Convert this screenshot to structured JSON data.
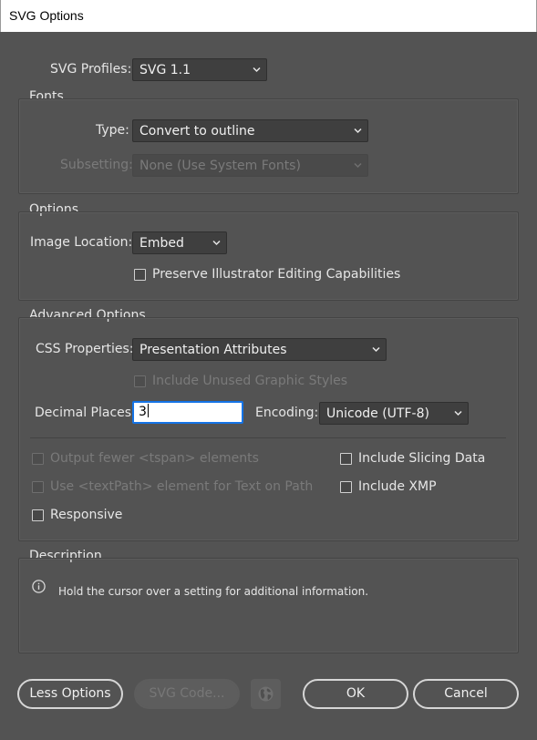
{
  "window": {
    "title": "SVG Options"
  },
  "profiles": {
    "label": "SVG Profiles:",
    "value": "SVG 1.1"
  },
  "fonts": {
    "title": "Fonts",
    "type_label": "Type:",
    "type_value": "Convert to outline",
    "subsetting_label": "Subsetting:",
    "subsetting_value": "None (Use System Fonts)"
  },
  "options": {
    "title": "Options",
    "image_location_label": "Image Location:",
    "image_location_value": "Embed",
    "preserve_label": "Preserve Illustrator Editing Capabilities"
  },
  "advanced": {
    "title": "Advanced Options",
    "css_label": "CSS Properties:",
    "css_value": "Presentation Attributes",
    "unused_styles_label": "Include Unused Graphic Styles",
    "decimal_label": "Decimal Places:",
    "decimal_value": "3",
    "encoding_label": "Encoding:",
    "encoding_value": "Unicode (UTF-8)",
    "fewer_tspan_label": "Output fewer <tspan> elements",
    "textpath_label": "Use <textPath> element for Text on Path",
    "responsive_label": "Responsive",
    "slicing_label": "Include Slicing Data",
    "xmp_label": "Include XMP"
  },
  "description": {
    "title": "Description",
    "text": "Hold the cursor over a setting for additional information."
  },
  "buttons": {
    "less_options": "Less Options",
    "svg_code": "SVG Code...",
    "ok": "OK",
    "cancel": "Cancel"
  },
  "colors": {
    "dialog_bg": "#535353",
    "field_bg": "#3f3f3f",
    "focus_border": "#1473e6"
  },
  "icons": {
    "info": "info-circle-icon",
    "globe": "globe-icon",
    "dropdown": "chevron-down-icon"
  }
}
